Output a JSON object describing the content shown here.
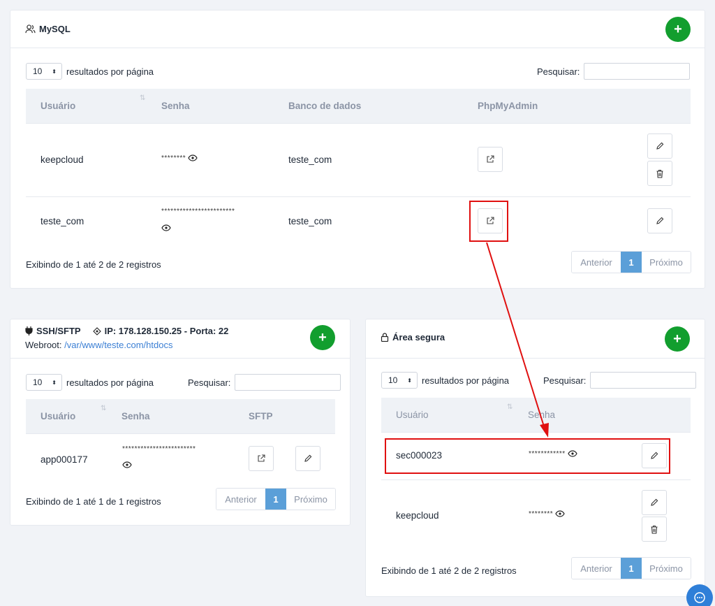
{
  "mysql": {
    "title": "MySQL",
    "add_icon": "plus-icon",
    "page_length": "10",
    "page_length_label": "resultados por página",
    "search_label": "Pesquisar:",
    "columns": [
      "Usuário",
      "Senha",
      "Banco de dados",
      "PhpMyAdmin"
    ],
    "rows": [
      {
        "user": "keepcloud",
        "password": "********",
        "database": "teste_com"
      },
      {
        "user": "teste_com",
        "password": "************************",
        "database": "teste_com"
      }
    ],
    "info": "Exibindo de 1 até 2 de 2 registros",
    "prev": "Anterior",
    "page": "1",
    "next": "Próximo"
  },
  "ssh": {
    "title": "SSH/SFTP",
    "ip_label": "IP: 178.128.150.25 - Porta: 22",
    "webroot_label": "Webroot:",
    "webroot_path": "/var/www/teste.com/htdocs",
    "page_length": "10",
    "page_length_label": "resultados por página",
    "search_label": "Pesquisar:",
    "columns": [
      "Usuário",
      "Senha",
      "SFTP"
    ],
    "rows": [
      {
        "user": "app000177",
        "password": "************************"
      }
    ],
    "info": "Exibindo de 1 até 1 de 1 registros",
    "prev": "Anterior",
    "page": "1",
    "next": "Próximo"
  },
  "secure": {
    "title": "Área segura",
    "page_length": "10",
    "page_length_label": "resultados por página",
    "search_label": "Pesquisar:",
    "columns": [
      "Usuário",
      "Senha"
    ],
    "rows": [
      {
        "user": "sec000023",
        "password": "************"
      },
      {
        "user": "keepcloud",
        "password": "********"
      }
    ],
    "info": "Exibindo de 1 até 2 de 2 registros",
    "prev": "Anterior",
    "page": "1",
    "next": "Próximo"
  },
  "colors": {
    "accent_green": "#129e2e",
    "page_active": "#5b9fd8",
    "annotation_red": "#e01010"
  }
}
